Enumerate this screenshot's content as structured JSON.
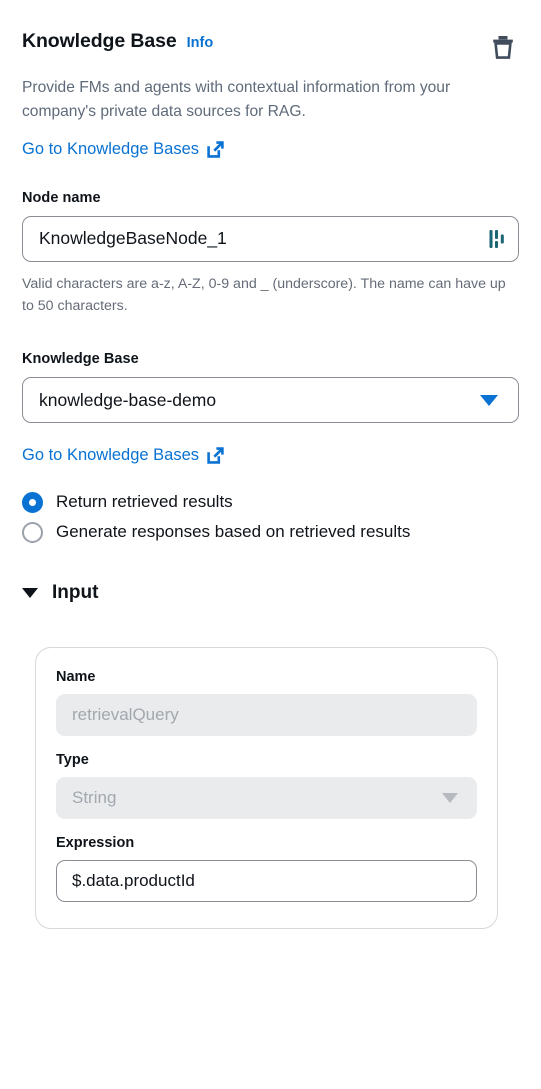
{
  "header": {
    "title": "Knowledge Base",
    "info_label": "Info",
    "delete_icon": "trash-icon"
  },
  "description": "Provide FMs and agents with contextual information from your company's private data sources for RAG.",
  "links": {
    "top_label": "Go to Knowledge Bases",
    "mid_label": "Go to Knowledge Bases",
    "icon": "external-link-icon"
  },
  "node_name": {
    "label": "Node name",
    "value": "KnowledgeBaseNode_1",
    "field_icon": "flow-node-icon",
    "hint": "Valid characters are a-z, A-Z, 0-9 and _ (underscore). The name can have up to 50 characters."
  },
  "knowledge_base": {
    "label": "Knowledge Base",
    "selected": "knowledge-base-demo",
    "caret_icon": "chevron-down-icon"
  },
  "mode_options": [
    {
      "label": "Return retrieved results",
      "selected": true
    },
    {
      "label": "Generate responses based on retrieved results",
      "selected": false
    }
  ],
  "input_section": {
    "title": "Input",
    "expanded": true,
    "caret_icon": "caret-down-icon",
    "fields": {
      "name_label": "Name",
      "name_placeholder": "retrievalQuery",
      "type_label": "Type",
      "type_placeholder": "String",
      "type_caret_icon": "chevron-down-icon",
      "expression_label": "Expression",
      "expression_value": "$.data.productId"
    }
  },
  "colors": {
    "link_blue": "#0972d3",
    "text_primary": "#0f141a",
    "text_secondary": "#5f6b7a",
    "icon_dark": "#414d5c",
    "node_icon_teal": "#1a6674",
    "disabled_bg": "#e9ebed",
    "border_grey": "#8c8c94"
  }
}
